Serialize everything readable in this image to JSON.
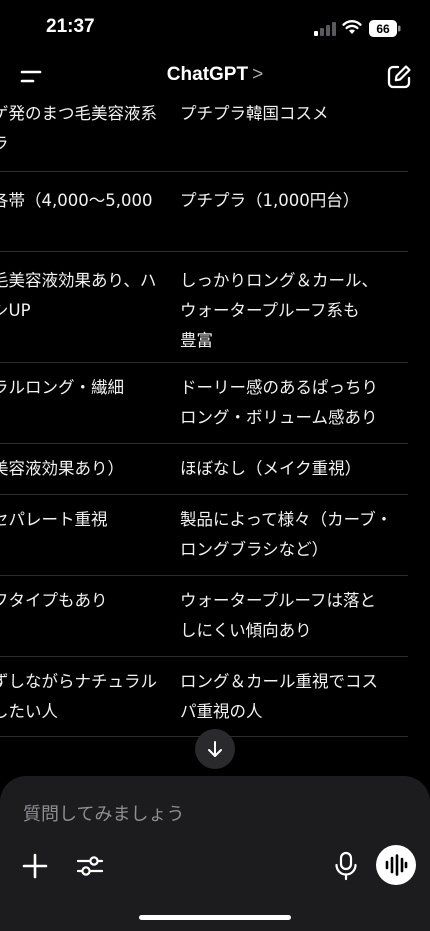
{
  "status": {
    "time": "21:37",
    "battery": "66"
  },
  "nav": {
    "title": "ChatGPT",
    "chevron": ">"
  },
  "table": {
    "rows": [
      {
        "a": [
          "ゲ発のまつ毛美容液系",
          "ラ"
        ],
        "b": [
          "プチプラ韓国コスメ"
        ]
      },
      {
        "a": [
          "各帯（4,000〜5,000",
          "）"
        ],
        "b": [
          "プチプラ（1,000円台）"
        ]
      },
      {
        "a": [
          "毛美容液効果あり、ハ",
          "シUP"
        ],
        "b": [
          "しっかりロング＆カール、",
          "ウォータープルーフ系も",
          "豊富"
        ]
      },
      {
        "a": [
          "ラルロング・繊細"
        ],
        "b": [
          "ドーリー感のあるぱっちり",
          "ロング・ボリューム感あり"
        ]
      },
      {
        "a": [
          "美容液効果あり）"
        ],
        "b": [
          "ほぼなし（メイク重視）"
        ]
      },
      {
        "a": [
          "セパレート重視"
        ],
        "b": [
          "製品によって様々（カーブ・",
          "ロングブラシなど）"
        ]
      },
      {
        "a": [
          "フタイプもあり"
        ],
        "b": [
          "ウォータープルーフは落と",
          "しにくい傾向あり"
        ]
      },
      {
        "a": [
          "ずしながらナチュラル",
          "したい人"
        ],
        "b": [
          "ロング＆カール重視でコス",
          "パ重視の人"
        ]
      }
    ]
  },
  "composer": {
    "placeholder": "質問してみましょう"
  },
  "icons": {
    "menu": "menu-icon",
    "compose": "compose-icon",
    "scroll": "arrow-down-icon",
    "plus": "plus-icon",
    "tools": "sliders-icon",
    "mic": "mic-icon",
    "voice": "voice-waveform-icon"
  }
}
